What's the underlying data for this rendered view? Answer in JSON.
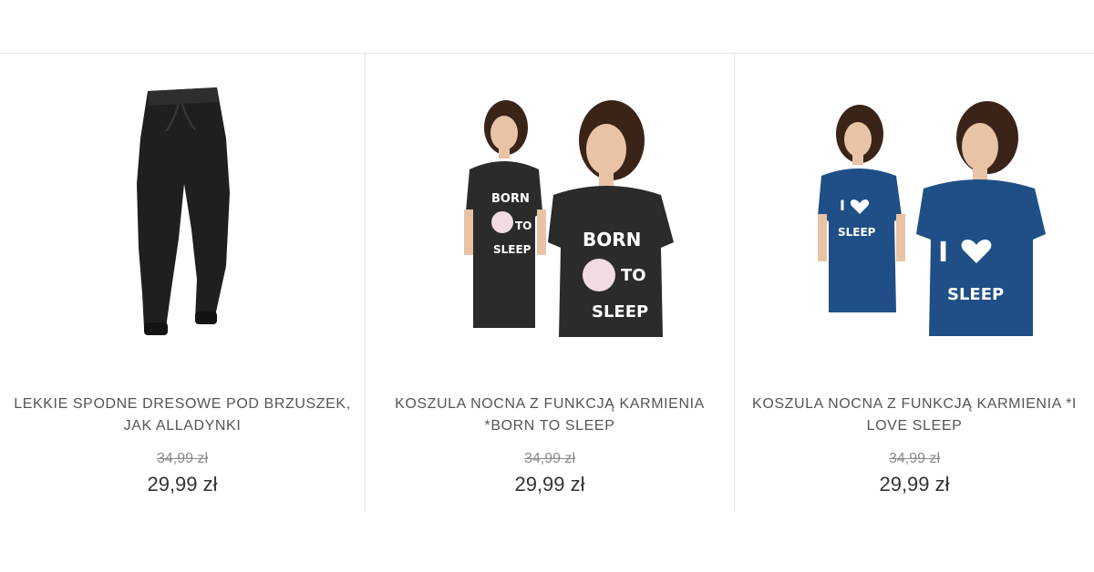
{
  "products": [
    {
      "name": "LEKKIE SPODNE DRESOWE POD BRZUSZEK, JAK ALLADYNKI",
      "old_price": "34,99 zł",
      "price": "29,99 zł",
      "image_icon": "pants-icon",
      "image_color": "#1f1f1f"
    },
    {
      "name": "KOSZULA NOCNA Z FUNKCJĄ KARMIENIA *BORN TO SLEEP",
      "old_price": "34,99 zł",
      "price": "29,99 zł",
      "image_icon": "nightgown-icon",
      "image_color": "#2b2b2b",
      "print_text": [
        "BORN",
        "TO",
        "SLEEP"
      ]
    },
    {
      "name": "KOSZULA NOCNA Z FUNKCJĄ KARMIENIA *I LOVE SLEEP",
      "old_price": "34,99 zł",
      "price": "29,99 zł",
      "image_icon": "nightgown-icon",
      "image_color": "#1f4f86",
      "print_text": [
        "I",
        "SLEEP"
      ]
    }
  ]
}
